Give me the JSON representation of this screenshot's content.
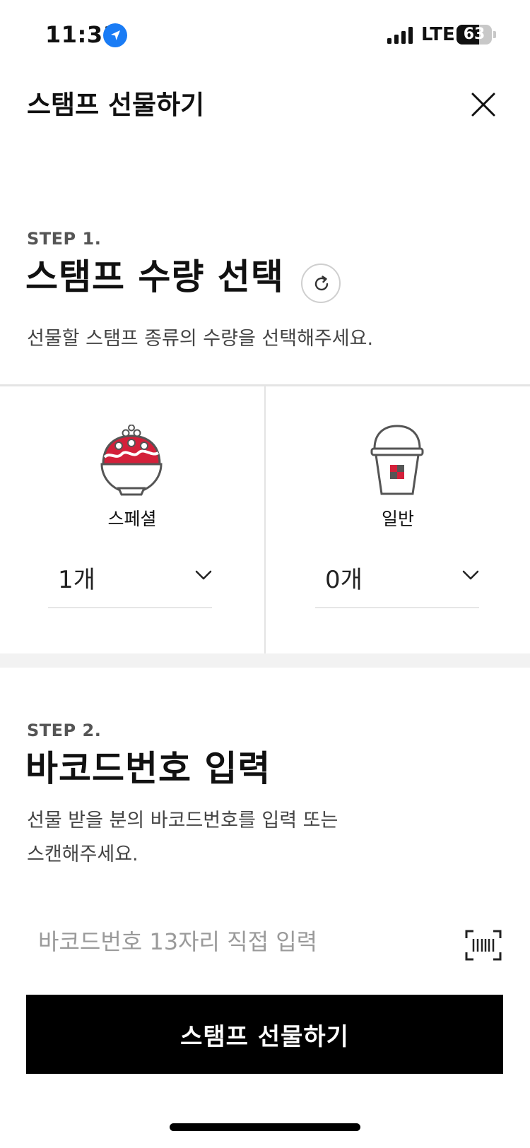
{
  "status_bar": {
    "time": "11:31",
    "network": "LTE",
    "battery": "63",
    "battery_level": 0.63
  },
  "header": {
    "title": "스탬프 선물하기"
  },
  "step1": {
    "label": "STEP 1.",
    "title": "스탬프 수량 선택",
    "description": "선물할 스탬프 종류의 수량을 선택해주세요.",
    "stamps": [
      {
        "name": "스페셜",
        "quantity": "1개"
      },
      {
        "name": "일반",
        "quantity": "0개"
      }
    ]
  },
  "step2": {
    "label": "STEP 2.",
    "title": "바코드번호 입력",
    "description_line1": "선물 받을 분의 바코드번호를 입력 또는",
    "description_line2": "스캔해주세요.",
    "input_placeholder": "바코드번호 13자리 직접 입력"
  },
  "submit": {
    "label": "스탬프 선물하기"
  },
  "colors": {
    "accent_red": "#d3203a",
    "button_bg": "#000000",
    "location_blue": "#1a7cf5"
  },
  "icons": [
    "location-arrow-icon",
    "signal-icon",
    "battery-icon",
    "close-icon",
    "refresh-icon",
    "special-stamp-icon",
    "regular-stamp-icon",
    "chevron-down-icon",
    "barcode-scan-icon"
  ]
}
